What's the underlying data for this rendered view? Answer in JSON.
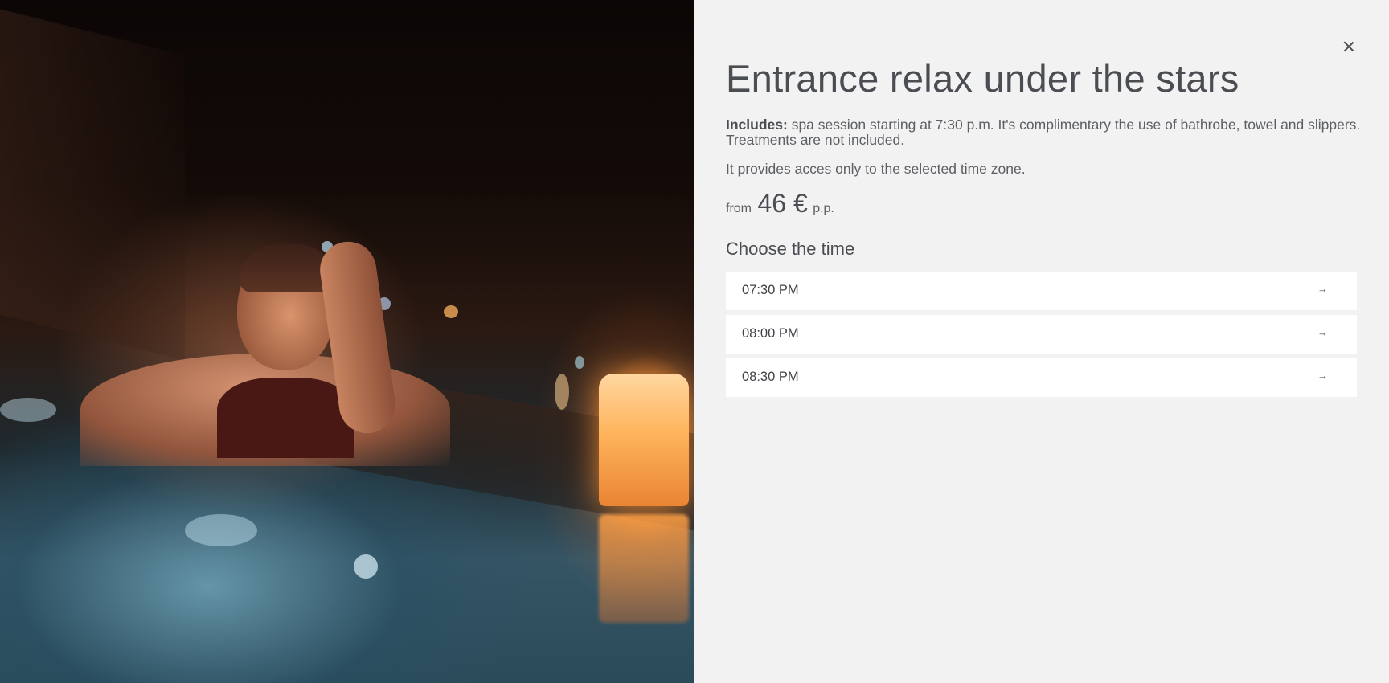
{
  "modal": {
    "photo_alt": "Woman relaxing in a pool at night beside a candle",
    "close_icon": "close-icon",
    "title": "Entrance relax under the stars",
    "includes_label": "Includes:",
    "includes_text": " spa session starting at 7:30 p.m. It's complimentary the use of bathrobe, towel and slippers. Treatments are not included.",
    "access_note": "It provides acces only to the selected time zone.",
    "price": {
      "from_label": "from",
      "amount": "46 €",
      "unit": "p.p."
    },
    "choose_heading": "Choose the time",
    "time_slots": [
      {
        "label": "07:30 PM",
        "arrow": "→"
      },
      {
        "label": "08:00 PM",
        "arrow": "→"
      },
      {
        "label": "08:30 PM",
        "arrow": "→"
      }
    ]
  },
  "colors": {
    "panel_background": "#f2f2f2",
    "slot_background": "#ffffff",
    "text_primary": "#4a4d52"
  }
}
